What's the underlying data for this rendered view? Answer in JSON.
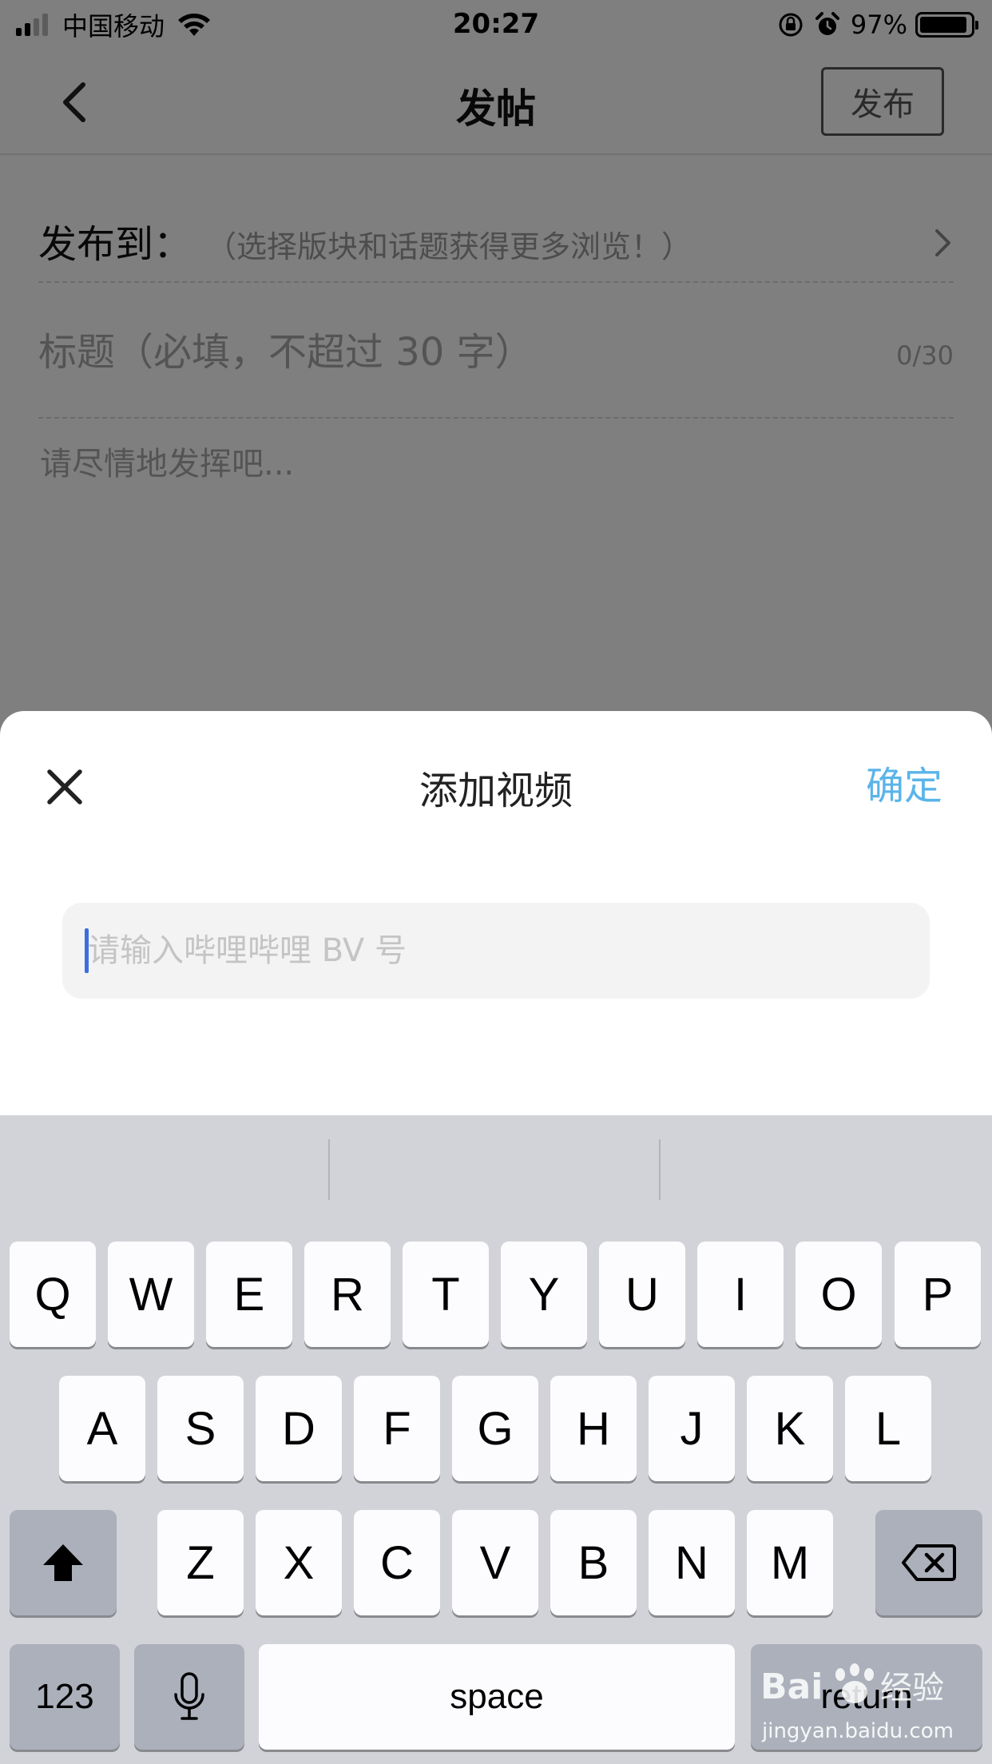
{
  "status_bar": {
    "carrier": "中国移动",
    "time": "20:27",
    "battery": "97%"
  },
  "nav": {
    "title": "发帖",
    "publish_label": "发布"
  },
  "form": {
    "publish_to_label": "发布到：",
    "publish_to_hint": "（选择版块和话题获得更多浏览！）",
    "title_placeholder": "标题（必填，不超过 30 字）",
    "title_value": "",
    "char_counter": "0/30",
    "body_placeholder": "请尽情地发挥吧...",
    "body_value": ""
  },
  "sheet": {
    "title": "添加视频",
    "confirm_label": "确定",
    "bv_placeholder": "请输入哔哩哔哩 BV 号",
    "bv_value": ""
  },
  "keyboard": {
    "row1": [
      "Q",
      "W",
      "E",
      "R",
      "T",
      "Y",
      "U",
      "I",
      "O",
      "P"
    ],
    "row2": [
      "A",
      "S",
      "D",
      "F",
      "G",
      "H",
      "J",
      "K",
      "L"
    ],
    "row3": [
      "Z",
      "X",
      "C",
      "V",
      "B",
      "N",
      "M"
    ],
    "numbers_label": "123",
    "space_label": "space",
    "return_label": "return",
    "icons": {
      "shift": "shift-icon",
      "delete": "backspace-icon",
      "dictation": "microphone-icon"
    }
  },
  "watermark": {
    "brand": "Bai 经验",
    "url": "jingyan.baidu.com"
  },
  "colors": {
    "accent": "#5ab4ea",
    "cursor": "#3b6fe0",
    "keyboard_bg": "#d2d3d8",
    "function_key": "#abb0bb"
  }
}
